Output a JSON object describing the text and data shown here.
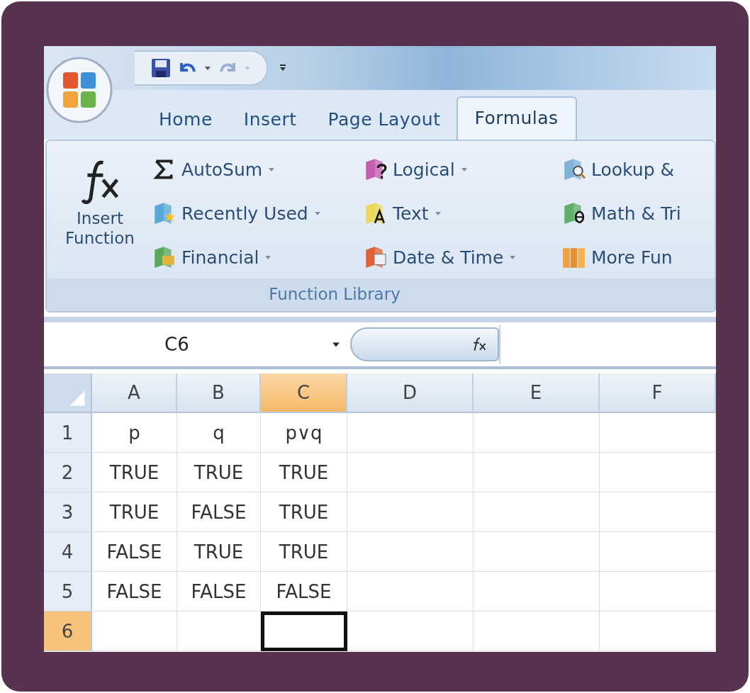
{
  "tabs": [
    {
      "label": "Home",
      "selected": false
    },
    {
      "label": "Insert",
      "selected": false
    },
    {
      "label": "Page Layout",
      "selected": false
    },
    {
      "label": "Formulas",
      "selected": true
    }
  ],
  "ribbon": {
    "insert_function": "Insert Function",
    "columns": [
      [
        {
          "kind": "sigma",
          "label": "AutoSum",
          "dropdown": true
        },
        {
          "kind": "star",
          "label": "Recently Used",
          "dropdown": true
        },
        {
          "kind": "money",
          "label": "Financial",
          "dropdown": true
        }
      ],
      [
        {
          "kind": "question",
          "label": "Logical",
          "dropdown": true
        },
        {
          "kind": "letter",
          "label": "Text",
          "dropdown": true
        },
        {
          "kind": "calendar",
          "label": "Date & Time",
          "dropdown": true
        }
      ],
      [
        {
          "kind": "search",
          "label": "Lookup &",
          "dropdown": false
        },
        {
          "kind": "theta",
          "label": "Math & Tri",
          "dropdown": false
        },
        {
          "kind": "books",
          "label": "More Fun",
          "dropdown": false
        }
      ]
    ],
    "group_label": "Function Library"
  },
  "formula_bar": {
    "name_box": "C6"
  },
  "sheet": {
    "columns": [
      {
        "label": "A",
        "selected": false
      },
      {
        "label": "B",
        "selected": false
      },
      {
        "label": "C",
        "selected": true
      },
      {
        "label": "D",
        "selected": false
      },
      {
        "label": "E",
        "selected": false
      },
      {
        "label": "F",
        "selected": false
      }
    ],
    "rows": [
      {
        "label": "1",
        "selected": false,
        "cells": [
          "p",
          "q",
          "p∨q"
        ]
      },
      {
        "label": "2",
        "selected": false,
        "cells": [
          "TRUE",
          "TRUE",
          "TRUE"
        ]
      },
      {
        "label": "3",
        "selected": false,
        "cells": [
          "TRUE",
          "FALSE",
          "TRUE"
        ]
      },
      {
        "label": "4",
        "selected": false,
        "cells": [
          "FALSE",
          "TRUE",
          "TRUE"
        ]
      },
      {
        "label": "5",
        "selected": false,
        "cells": [
          "FALSE",
          "FALSE",
          "FALSE"
        ]
      },
      {
        "label": "6",
        "selected": true
      }
    ]
  }
}
